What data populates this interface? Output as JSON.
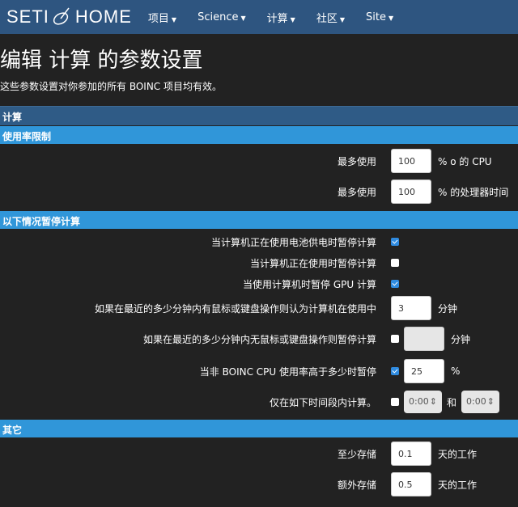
{
  "nav": {
    "logo": "SETI@HOME",
    "items": [
      "项目",
      "Science",
      "计算",
      "社区",
      "Site"
    ]
  },
  "title": "编辑 计算 的参数设置",
  "subtitle": "这些参数设置对你参加的所有 BOINC 项目均有效。",
  "section": "计算",
  "usage": {
    "header": "使用率限制",
    "rows": [
      {
        "label": "最多使用",
        "value": "100",
        "unit": "% o 的 CPU"
      },
      {
        "label": "最多使用",
        "value": "100",
        "unit": "% 的处理器时间"
      }
    ]
  },
  "suspend": {
    "header": "以下情况暂停计算",
    "battery": {
      "label": "当计算机正在使用电池供电时暂停计算",
      "checked": true
    },
    "in_use": {
      "label": "当计算机正在使用时暂停计算",
      "checked": false
    },
    "gpu": {
      "label": "当使用计算机时暂停 GPU 计算",
      "checked": true
    },
    "idle": {
      "label": "如果在最近的多少分钟内有鼠标或键盘操作则认为计算机在使用中",
      "value": "3",
      "unit": "分钟"
    },
    "no_input": {
      "label": "如果在最近的多少分钟内无鼠标或键盘操作则暂停计算",
      "checked": false,
      "value": "",
      "unit": "分钟"
    },
    "cpu": {
      "label": "当非 BOINC CPU 使用率高于多少时暂停",
      "checked": true,
      "value": "25",
      "unit": "%"
    },
    "time": {
      "label": "仅在如下时间段内计算。",
      "checked": false,
      "start": "0:00",
      "and": "和",
      "end": "0:00"
    }
  },
  "other": {
    "header": "其它",
    "rows": [
      {
        "label": "至少存储",
        "value": "0.1",
        "unit": "天的工作"
      },
      {
        "label": "额外存储",
        "value": "0.5",
        "unit": "天的工作"
      }
    ]
  }
}
